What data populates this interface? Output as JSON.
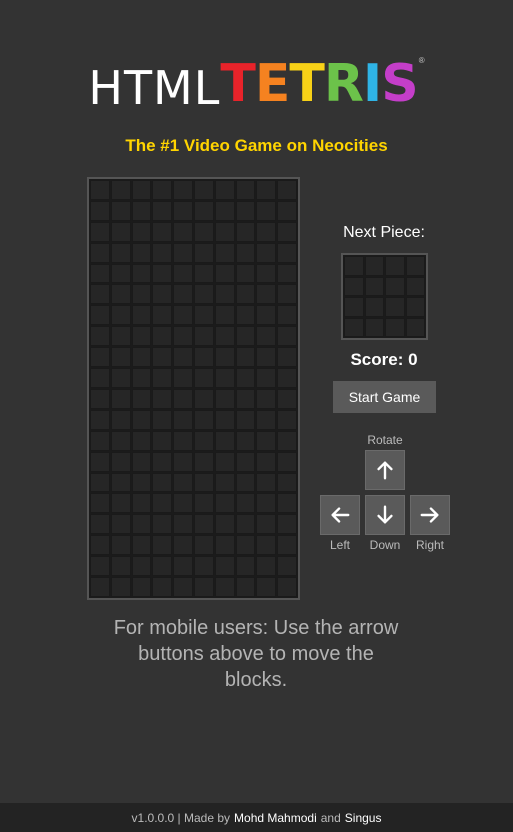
{
  "logo": {
    "html_text": "HTML",
    "tetris_letters": [
      {
        "ch": "T",
        "color": "#e8232a"
      },
      {
        "ch": "E",
        "color": "#f58220"
      },
      {
        "ch": "T",
        "color": "#f7d117"
      },
      {
        "ch": "R",
        "color": "#6cc24a"
      },
      {
        "ch": "I",
        "color": "#2fb4e6"
      },
      {
        "ch": "S",
        "color": "#c43ec9"
      }
    ],
    "reg": "®"
  },
  "tagline": "The #1 Video Game on Neocities",
  "panel": {
    "next_label": "Next Piece:",
    "score_label": "Score: 0",
    "start_label": "Start Game"
  },
  "controls": {
    "rotate_label": "Rotate",
    "left_label": "Left",
    "down_label": "Down",
    "right_label": "Right"
  },
  "mobile_note": "For mobile users: Use the arrow buttons above to move the blocks.",
  "footer": {
    "version_text": "v1.0.0.0 | Made by",
    "author1": "Mohd Mahmodi",
    "and_text": "and",
    "author2": "Singus"
  },
  "colors": {
    "background": "#333333",
    "tagline": "#ffd400",
    "button": "#5a5a5a"
  },
  "icons": [
    "arrow-up-icon",
    "arrow-left-icon",
    "arrow-down-icon",
    "arrow-right-icon"
  ]
}
